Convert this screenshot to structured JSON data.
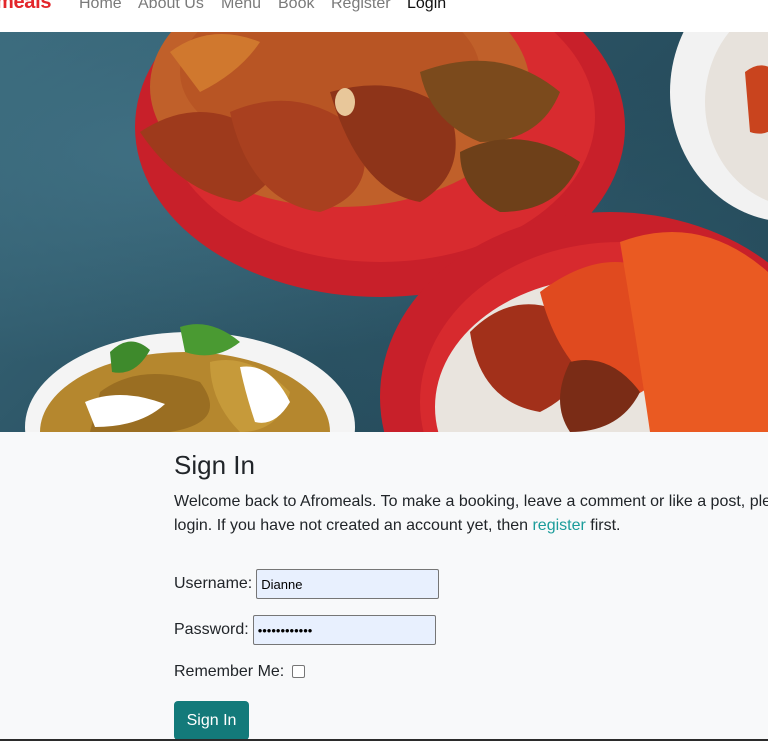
{
  "navbar": {
    "brand": "meals",
    "links": [
      "Home",
      "About Us",
      "Menu",
      "Book",
      "Register",
      "Login"
    ],
    "active_index": 5
  },
  "hero": {
    "image_alt": "Nigerian jollof rice, chicken and plantain dishes"
  },
  "signin": {
    "title": "Sign In",
    "intro_before_link": "Welcome back to Afromeals. To make a booking, leave a comment or like a post, please login. If you have not created an account yet, then ",
    "register_link": "register",
    "intro_after_link": " first.",
    "username_label": "Username:",
    "username_value": "Dianne",
    "password_label": "Password:",
    "password_value": "••••••••••••",
    "remember_label": "Remember Me:",
    "submit_label": "Sign In"
  },
  "colors": {
    "brand": "#e3262b",
    "primary_button": "#137a7a",
    "link": "#1a9c9a",
    "page_background": "#f8f9fa"
  }
}
